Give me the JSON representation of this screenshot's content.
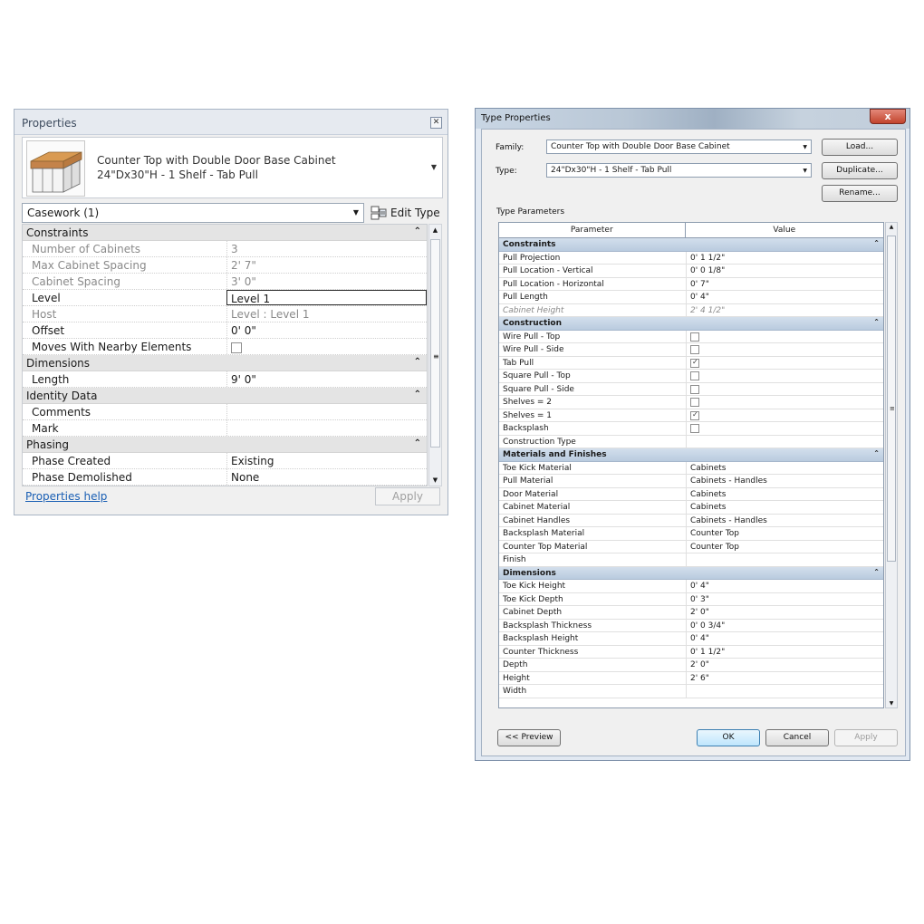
{
  "properties": {
    "title": "Properties",
    "family": "Counter Top with Double Door Base Cabinet",
    "type": "24\"Dx30\"H - 1 Shelf - Tab Pull",
    "category": "Casework (1)",
    "edit_type": "Edit Type",
    "help": "Properties help",
    "apply": "Apply",
    "groups": [
      {
        "name": "Constraints",
        "rows": [
          {
            "k": "Number of Cabinets",
            "v": "3",
            "ro": true
          },
          {
            "k": "Max Cabinet Spacing",
            "v": "2'  7\"",
            "ro": true
          },
          {
            "k": "Cabinet Spacing",
            "v": "3'  0\"",
            "ro": true
          },
          {
            "k": "Level",
            "v": "Level 1",
            "sel": true
          },
          {
            "k": "Host",
            "v": "Level : Level 1",
            "ro": true
          },
          {
            "k": "Offset",
            "v": "0'  0\""
          },
          {
            "k": "Moves With Nearby Elements",
            "v": "",
            "check": false
          }
        ]
      },
      {
        "name": "Dimensions",
        "rows": [
          {
            "k": "Length",
            "v": "9'  0\""
          }
        ]
      },
      {
        "name": "Identity Data",
        "rows": [
          {
            "k": "Comments",
            "v": ""
          },
          {
            "k": "Mark",
            "v": ""
          }
        ]
      },
      {
        "name": "Phasing",
        "rows": [
          {
            "k": "Phase Created",
            "v": "Existing"
          },
          {
            "k": "Phase Demolished",
            "v": "None"
          }
        ]
      }
    ]
  },
  "type_properties": {
    "title": "Type Properties",
    "close": "x",
    "family_label": "Family:",
    "family_value": "Counter Top with Double Door Base Cabinet",
    "type_label": "Type:",
    "type_value": "24\"Dx30\"H - 1 Shelf - Tab Pull",
    "load": "Load...",
    "duplicate": "Duplicate...",
    "rename": "Rename...",
    "type_parameters": "Type Parameters",
    "col_parameter": "Parameter",
    "col_value": "Value",
    "preview": "<< Preview",
    "ok": "OK",
    "cancel": "Cancel",
    "apply": "Apply",
    "groups": [
      {
        "name": "Constraints",
        "rows": [
          {
            "k": "Pull Projection",
            "v": "0'  1 1/2\""
          },
          {
            "k": "Pull Location - Vertical",
            "v": "0'  0 1/8\""
          },
          {
            "k": "Pull Location - Horizontal",
            "v": "0'  7\""
          },
          {
            "k": "Pull Length",
            "v": "0'  4\""
          },
          {
            "k": "Cabinet Height",
            "v": "2'  4 1/2\"",
            "ro": true
          }
        ]
      },
      {
        "name": "Construction",
        "rows": [
          {
            "k": "Wire Pull - Top",
            "v": "",
            "check": false
          },
          {
            "k": "Wire Pull - Side",
            "v": "",
            "check": false
          },
          {
            "k": "Tab Pull",
            "v": "",
            "check": true
          },
          {
            "k": "Square Pull - Top",
            "v": "",
            "check": false
          },
          {
            "k": "Square Pull - Side",
            "v": "",
            "check": false
          },
          {
            "k": "Shelves = 2",
            "v": "",
            "check": false
          },
          {
            "k": "Shelves = 1",
            "v": "",
            "check": true
          },
          {
            "k": "Backsplash",
            "v": "",
            "check": false
          },
          {
            "k": "Construction Type",
            "v": ""
          }
        ]
      },
      {
        "name": "Materials and Finishes",
        "rows": [
          {
            "k": "Toe Kick Material",
            "v": "Cabinets"
          },
          {
            "k": "Pull Material",
            "v": "Cabinets - Handles"
          },
          {
            "k": "Door Material",
            "v": "Cabinets"
          },
          {
            "k": "Cabinet Material",
            "v": "Cabinets"
          },
          {
            "k": "Cabinet Handles",
            "v": "Cabinets - Handles"
          },
          {
            "k": "Backsplash Material",
            "v": "Counter Top"
          },
          {
            "k": "Counter Top Material",
            "v": "Counter Top"
          },
          {
            "k": "Finish",
            "v": ""
          }
        ]
      },
      {
        "name": "Dimensions",
        "rows": [
          {
            "k": "Toe Kick Height",
            "v": "0'  4\""
          },
          {
            "k": "Toe Kick Depth",
            "v": "0'  3\""
          },
          {
            "k": "Cabinet Depth",
            "v": "2'  0\""
          },
          {
            "k": "Backsplash Thickness",
            "v": "0'  0 3/4\""
          },
          {
            "k": "Backsplash Height",
            "v": "0'  4\""
          },
          {
            "k": "Counter Thickness",
            "v": "0'  1 1/2\""
          },
          {
            "k": "Depth",
            "v": "2'  0\""
          },
          {
            "k": "Height",
            "v": "2'  6\""
          },
          {
            "k": "Width",
            "v": ""
          }
        ]
      }
    ]
  }
}
